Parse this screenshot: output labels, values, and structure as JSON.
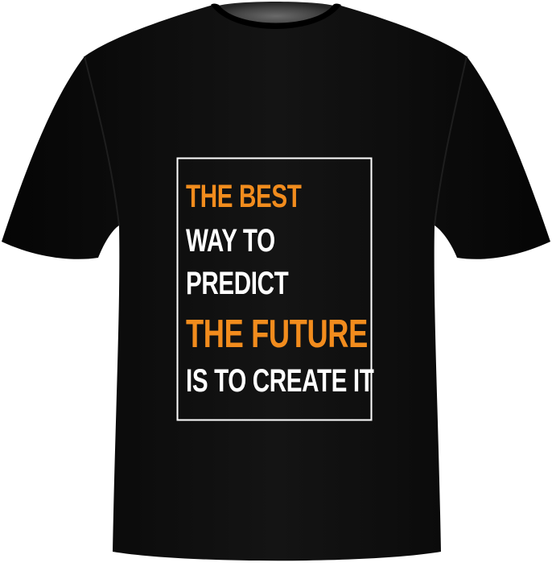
{
  "print": {
    "lines": [
      {
        "text": "THE BEST",
        "color": "#f28c1d"
      },
      {
        "text": "WAY TO",
        "color": "#ffffff"
      },
      {
        "text": "PREDICT",
        "color": "#ffffff"
      },
      {
        "text": "THE FUTURE",
        "color": "#f28c1d"
      },
      {
        "text": "IS TO CREATE IT",
        "color": "#ffffff"
      }
    ],
    "frame_color": "#ffffff"
  },
  "shirt": {
    "color": "#0a0a0a",
    "collar_inner_color": "#3a3a3a"
  }
}
